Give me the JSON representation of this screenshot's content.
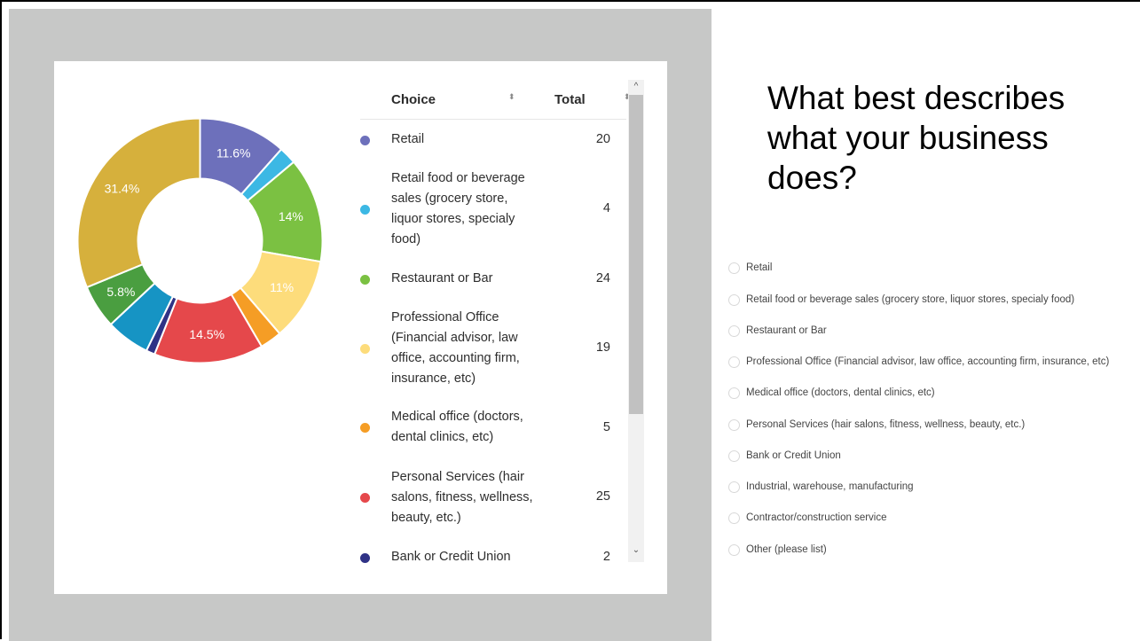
{
  "chart_data": {
    "type": "pie",
    "donut": true,
    "slices": [
      {
        "label": "Retail",
        "value": 20,
        "color": "#6d70bb",
        "data_label": "11.6%"
      },
      {
        "label": "Retail food or beverage sales (grocery store, liquor stores, specialy food)",
        "value": 4,
        "color": "#3cb8e4",
        "data_label": ""
      },
      {
        "label": "Restaurant or Bar",
        "value": 24,
        "color": "#7bc142",
        "data_label": "14%"
      },
      {
        "label": "Professional Office (Financial advisor, law office, accounting firm, insurance, etc)",
        "value": 19,
        "color": "#fddc7b",
        "data_label": "11%"
      },
      {
        "label": "Medical office (doctors, dental clinics, etc)",
        "value": 5,
        "color": "#f59d25",
        "data_label": ""
      },
      {
        "label": "Personal Services (hair salons, fitness, wellness, beauty, etc.)",
        "value": 25,
        "color": "#e5484b",
        "data_label": "14.5%"
      },
      {
        "label": "Bank or Credit Union",
        "value": 2,
        "color": "#2f3286",
        "data_label": ""
      },
      {
        "label": "",
        "value": 10,
        "color": "#1694c4",
        "data_label": ""
      },
      {
        "label": "",
        "value": 10,
        "color": "#4a9e40",
        "data_label": "5.8%"
      },
      {
        "label": "",
        "value": 54,
        "color": "#d6b03c",
        "data_label": "31.4%"
      }
    ]
  },
  "table": {
    "header_choice": "Choice",
    "header_total": "Total",
    "sort_icon": "⬍",
    "rows": [
      {
        "choice": "Retail",
        "total": "20",
        "color": "#6d70bb"
      },
      {
        "choice": "Retail food or beverage sales (grocery store, liquor stores, specialy food)",
        "total": "4",
        "color": "#3cb8e4"
      },
      {
        "choice": "Restaurant or Bar",
        "total": "24",
        "color": "#7bc142"
      },
      {
        "choice": "Professional Office (Financial advisor, law office, accounting firm, insurance, etc)",
        "total": "19",
        "color": "#fddc7b"
      },
      {
        "choice": "Medical office (doctors, dental clinics, etc)",
        "total": "5",
        "color": "#f59d25"
      },
      {
        "choice": "Personal Services (hair salons, fitness, wellness, beauty, etc.)",
        "total": "25",
        "color": "#e5484b"
      },
      {
        "choice": "Bank or Credit Union",
        "total": "2",
        "color": "#2f3286"
      }
    ]
  },
  "scrollbar": {
    "up_icon": "^",
    "down_icon": "⌄"
  },
  "question": "What best describes what your business does?",
  "options": [
    "Retail",
    "Retail food or beverage sales (grocery store, liquor stores, specialy food)",
    "Restaurant or Bar",
    "Professional Office (Financial advisor, law office, accounting firm, insurance, etc)",
    "Medical office (doctors, dental clinics, etc)",
    "Personal Services (hair salons, fitness, wellness, beauty, etc.)",
    "Bank or Credit Union",
    "Industrial, warehouse, manufacturing",
    "Contractor/construction service",
    "Other (please list)"
  ]
}
